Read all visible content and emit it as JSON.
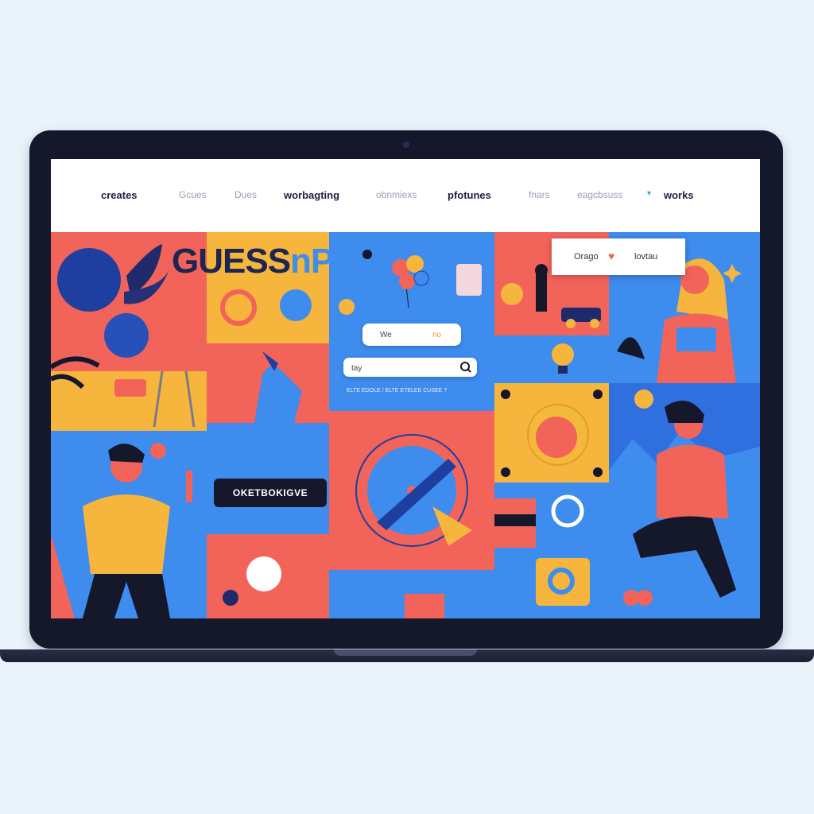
{
  "nav": {
    "items": [
      {
        "label": "creates",
        "bold": true
      },
      {
        "label": "Gcues",
        "bold": false
      },
      {
        "label": "Dues",
        "bold": false
      },
      {
        "label": "worbagting",
        "bold": true
      },
      {
        "label": "obnmiexs",
        "bold": false
      },
      {
        "label": "pfotunes",
        "bold": true
      },
      {
        "label": "fnars",
        "bold": false
      },
      {
        "label": "eagcbsuss",
        "bold": false
      },
      {
        "label": "works",
        "bold": true
      }
    ]
  },
  "hero": {
    "brand_main": "GUESS",
    "brand_accent": "nP",
    "cta_label": "OKETBOKIGVE"
  },
  "pills": {
    "left": "We",
    "right": "no"
  },
  "search": {
    "value": "tay"
  },
  "caption": "ELTE EDOLE / ELTE ETELEE CUSEE ?",
  "popup": {
    "left": "Orago",
    "right": "lovtau"
  },
  "colors": {
    "coral": "#f2635a",
    "blue": "#3d8cee",
    "yellow": "#f6b53c",
    "navy": "#15172b",
    "navy_ink": "#1d2552"
  },
  "icons": [
    "search-icon",
    "heart-icon",
    "lightbulb-icon",
    "balloons-icon",
    "q-logo-icon"
  ]
}
